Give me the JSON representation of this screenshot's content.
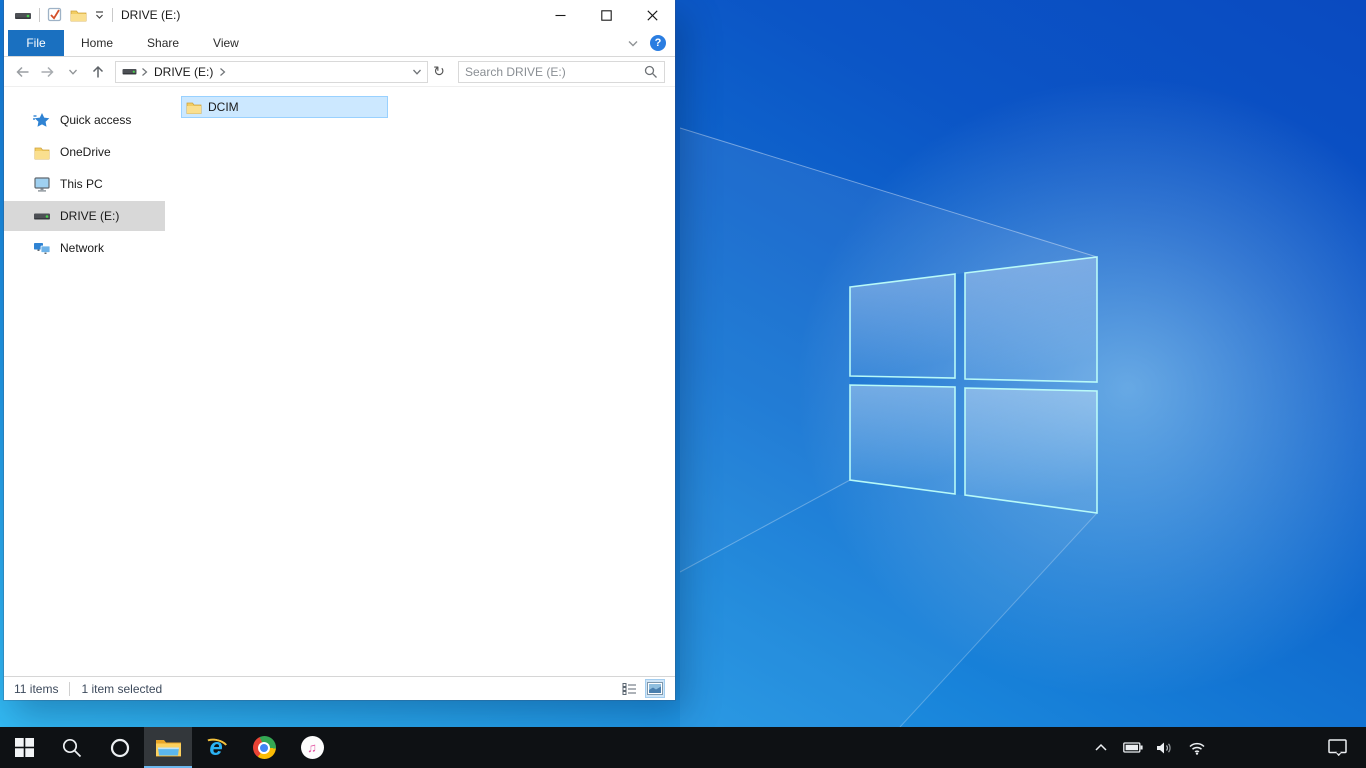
{
  "explorer": {
    "titlebar": {
      "title": "DRIVE (E:)"
    },
    "ribbon": {
      "tabs": [
        {
          "label": "File",
          "active": true
        },
        {
          "label": "Home",
          "active": false
        },
        {
          "label": "Share",
          "active": false
        },
        {
          "label": "View",
          "active": false
        }
      ],
      "help_glyph": "?"
    },
    "navbar": {
      "breadcrumb": [
        {
          "label": "DRIVE (E:)"
        }
      ],
      "search_placeholder": "Search DRIVE (E:)",
      "refresh_glyph": "↻"
    },
    "sidebar": {
      "items": [
        {
          "label": "Quick access",
          "icon": "quick-access-star",
          "selected": false
        },
        {
          "label": "OneDrive",
          "icon": "folder",
          "selected": false
        },
        {
          "label": "This PC",
          "icon": "monitor",
          "selected": false
        },
        {
          "label": "DRIVE (E:)",
          "icon": "drive",
          "selected": true
        },
        {
          "label": "Network",
          "icon": "network",
          "selected": false
        }
      ]
    },
    "content": {
      "files": [
        {
          "name": "DCIM",
          "icon": "folder",
          "selected": true
        }
      ]
    },
    "statusbar": {
      "items_count": "11 items",
      "selected_count": "1 item selected"
    }
  },
  "taskbar": {
    "items": [
      {
        "icon": "start"
      },
      {
        "icon": "search"
      },
      {
        "icon": "cortana"
      },
      {
        "icon": "file-explorer",
        "active": true
      },
      {
        "icon": "internet-explorer",
        "glyph": "e"
      },
      {
        "icon": "chrome"
      },
      {
        "icon": "itunes",
        "glyph": "♫"
      }
    ],
    "tray_icons": [
      "chevron-up",
      "battery",
      "volume",
      "wifi"
    ],
    "action_center_icon": "action-center"
  },
  "colors": {
    "accent_tab": "#1a70c0",
    "selection_fill": "#cce8ff",
    "selection_border": "#99d1ff",
    "sidebar_selected": "#d8d8d8",
    "taskbar_bg": "#0e1114",
    "taskbar_underline": "#6cb8ef"
  }
}
